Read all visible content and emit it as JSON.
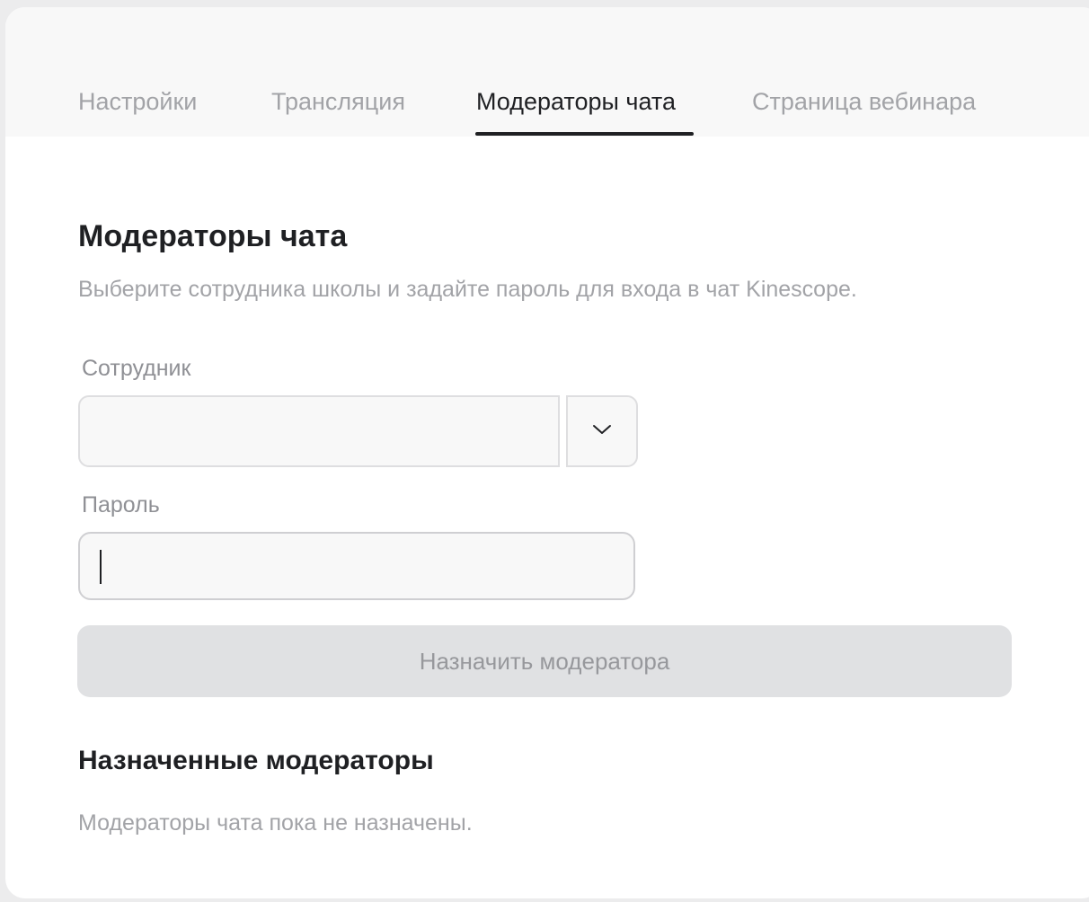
{
  "tabs": [
    {
      "label": "Настройки",
      "active": false
    },
    {
      "label": "Трансляция",
      "active": false
    },
    {
      "label": "Модераторы чата",
      "active": true
    },
    {
      "label": "Страница вебинара",
      "active": false
    }
  ],
  "main": {
    "title": "Модераторы чата",
    "description": "Выберите сотрудника школы и задайте пароль для входа в чат Kinescope.",
    "employee_label": "Сотрудник",
    "employee_value": "",
    "password_label": "Пароль",
    "password_value": "",
    "assign_button_label": "Назначить модератора",
    "assigned_title": "Назначенные модераторы",
    "assigned_empty_text": "Модераторы чата пока не назначены."
  },
  "icons": {
    "dropdown": "chevron-down-icon"
  },
  "colors": {
    "text_primary": "#1f2023",
    "text_muted": "#a2a3a7",
    "button_disabled_bg": "#e0e1e3"
  }
}
